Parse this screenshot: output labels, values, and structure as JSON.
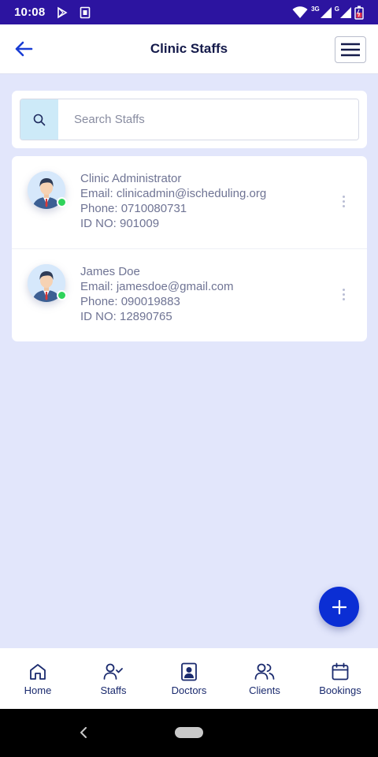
{
  "status_bar": {
    "time": "10:08",
    "network_label": "3G",
    "network_label_2": "G"
  },
  "header": {
    "title": "Clinic Staffs"
  },
  "search": {
    "placeholder": "Search Staffs",
    "value": ""
  },
  "staff": [
    {
      "name": "Clinic Administrator",
      "email": "Email: clinicadmin@ischeduling.org",
      "phone": "Phone: 0710080731",
      "id_no": "ID NO: 901009",
      "online": true
    },
    {
      "name": "James Doe",
      "email": "Email: jamesdoe@gmail.com",
      "phone": "Phone: 090019883",
      "id_no": "ID NO: 12890765",
      "online": true
    }
  ],
  "bottom_nav": {
    "items": [
      {
        "label": "Home",
        "icon": "home-icon"
      },
      {
        "label": "Staffs",
        "icon": "user-check-icon"
      },
      {
        "label": "Doctors",
        "icon": "doctor-badge-icon"
      },
      {
        "label": "Clients",
        "icon": "users-icon"
      },
      {
        "label": "Bookings",
        "icon": "calendar-icon"
      }
    ]
  },
  "colors": {
    "status_bar": "#2c14a0",
    "background": "#e2e6fb",
    "accent": "#0b2ed4",
    "nav_text": "#1a2a6e",
    "online": "#2fd35b"
  }
}
